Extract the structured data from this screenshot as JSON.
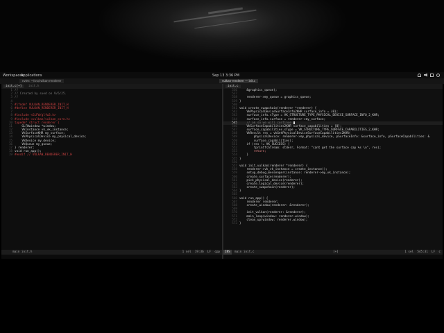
{
  "topbar": {
    "workspaces": "Workspaces",
    "applications": "Applications",
    "clock": "Sep 13 3:36 PM"
  },
  "windows": [
    {
      "title": "nvim: ~/src/vulkan-renderer"
    },
    {
      "title": "vulkan-renderer — init.c"
    }
  ],
  "left_pane": {
    "tab_label": "init.c[+]",
    "tab_path": "init.h",
    "lines": [
      {
        "n": "1",
        "t": "//",
        "k": "c-comment"
      },
      {
        "n": "2",
        "t": "// Created by sued on 9/6/25.",
        "k": "c-comment"
      },
      {
        "n": "3",
        "t": "//",
        "k": "c-comment"
      },
      {
        "n": "4",
        "t": "",
        "k": "tx"
      },
      {
        "n": "5",
        "t": "#ifndef VULKAN_RENDERER_INIT_H",
        "k": "c-pre"
      },
      {
        "n": "6",
        "t": "#define VULKAN_RENDERER_INIT_H",
        "k": "c-pre"
      },
      {
        "n": "7",
        "t": "",
        "k": "tx"
      },
      {
        "n": "8",
        "t": "#include <GLFW/glfw3.h>",
        "k": "c-pre"
      },
      {
        "n": "9",
        "t": "#include <vulkan/vulkan_core.h>",
        "k": "c-pre"
      },
      {
        "n": "10",
        "t": "typedef struct renderer {",
        "k": "c-pre"
      },
      {
        "n": "11",
        "t": "    GLFWwindow *window;",
        "k": "tx"
      },
      {
        "n": "12",
        "t": "    VkInstance vk_vk_instance;",
        "k": "tx"
      },
      {
        "n": "13",
        "t": "    VkSurfaceKHR my_surface;",
        "k": "tx"
      },
      {
        "n": "14",
        "t": "    VkPhysicalDevice my_physical_device;",
        "k": "tx"
      },
      {
        "n": "15",
        "t": "    VkDevice my_device;",
        "k": "tx"
      },
      {
        "n": "16",
        "t": "    VkQueue my_queue;",
        "k": "tx"
      },
      {
        "n": "17",
        "t": "} renderer;",
        "k": "tx"
      },
      {
        "n": "18",
        "t": "void run_app();",
        "k": "tx"
      },
      {
        "n": "19",
        "t": "#endif // VULKAN_RENDERER_INIT_H",
        "k": "c-pre"
      }
    ],
    "status": {
      "mode": "",
      "file": "main init.h",
      "sel": "1 sel",
      "pos": "19:36",
      "eol": "LF",
      "ft": "cpp"
    }
  },
  "right_pane": {
    "tab_label": "init.c",
    "lines": [
      {
        "n": "536",
        "t": "    &graphics_queue);",
        "k": "tx"
      },
      {
        "n": "537",
        "t": "",
        "k": "tx"
      },
      {
        "n": "538",
        "t": "    renderer->my_queue = graphics_queue;",
        "k": "tx"
      },
      {
        "n": "539",
        "t": "}",
        "k": "tx"
      },
      {
        "n": "540",
        "t": "",
        "k": "tx"
      },
      {
        "n": "541",
        "t": "void create_swapchain(renderer *renderer) {",
        "k": "tx"
      },
      {
        "n": "542",
        "t": "    VkPhysicalDeviceSurfaceInfo2KHR surface_info = {0};",
        "k": "tx"
      },
      {
        "n": "543",
        "t": "    surface_info.sType = VK_STRUCTURE_TYPE_PHYSICAL_DEVICE_SURFACE_INFO_2_KHR;",
        "k": "tx"
      },
      {
        "n": "544",
        "t": "    surface_info.surface = renderer->my_surface;",
        "k": "tx"
      },
      {
        "n": "545",
        "t": "    // ok so we will continue ",
        "k": "c-comment",
        "cur": true
      },
      {
        "n": "546",
        "t": "    VkSurfaceCapabilities2KHR surface_capabilities = {0};",
        "k": "tx"
      },
      {
        "n": "547",
        "t": "    surface_capabilities.sType = VK_STRUCTURE_TYPE_SURFACE_CAPABILITIES_2_KHR;",
        "k": "tx"
      },
      {
        "n": "548",
        "t": "    VkResult res = vkGetPhysicalDeviceSurfaceCapabilities2KHR(",
        "k": "tx"
      },
      {
        "n": "549",
        "t": "        physicalDevice: renderer->my_physical_device, pSurfaceInfo: &surface_info, pSurfaceCapabilities: &",
        "k": "tx"
      },
      {
        "n": "550",
        "t": "        surface_capabilities);",
        "k": "tx"
      },
      {
        "n": "551",
        "t": "    if (res != VK_SUCCESS) {",
        "k": "tx"
      },
      {
        "n": "552",
        "t": "        fprintf(Stream: stderr, Format: \"cant get the surface cap %s \\n\", res);",
        "k": "tx"
      },
      {
        "n": "553",
        "t": "        return;",
        "k": "c-str"
      },
      {
        "n": "554",
        "t": "    }",
        "k": "tx"
      },
      {
        "n": "555",
        "t": "}",
        "k": "tx"
      },
      {
        "n": "556",
        "t": "",
        "k": "tx"
      },
      {
        "n": "557",
        "t": "void init_vulkan(renderer *renderer) {",
        "k": "tx"
      },
      {
        "n": "558",
        "t": "    renderer->vk_vk_instance = create_instance();",
        "k": "tx"
      },
      {
        "n": "559",
        "t": "    setup_debug_messenger(instance: renderer->my_vk_instance);",
        "k": "tx"
      },
      {
        "n": "560",
        "t": "    create_surface(renderer);",
        "k": "tx"
      },
      {
        "n": "561",
        "t": "    pick_physical_device(renderer);",
        "k": "tx"
      },
      {
        "n": "562",
        "t": "    create_logical_device(renderer);",
        "k": "tx"
      },
      {
        "n": "563",
        "t": "    create_swapchain(renderer);",
        "k": "tx"
      },
      {
        "n": "564",
        "t": "}",
        "k": "tx"
      },
      {
        "n": "565",
        "t": "",
        "k": "tx"
      },
      {
        "n": "566",
        "t": "void run_app() {",
        "k": "tx"
      },
      {
        "n": "567",
        "t": "    renderer renderer;",
        "k": "tx"
      },
      {
        "n": "568",
        "t": "    create_window(renderer: &renderer);",
        "k": "tx"
      },
      {
        "n": "569",
        "t": "",
        "k": "tx"
      },
      {
        "n": "570",
        "t": "    init_vulkan(renderer: &renderer);",
        "k": "tx"
      },
      {
        "n": "571",
        "t": "    main_loop(window: renderer.window);",
        "k": "tx"
      },
      {
        "n": "572",
        "t": "    clean_up(window: renderer.window);",
        "k": "tx"
      },
      {
        "n": "573",
        "t": "}",
        "k": "tx"
      }
    ],
    "status": {
      "mode": "INS",
      "file": "main init.c",
      "modified": "[+]",
      "sel": "1 sel",
      "pos": "545:31",
      "eol": "LF",
      "ft": "c"
    }
  },
  "colors": {
    "background": "#000000",
    "editor_bg": "#101010",
    "preprocessor": "#c84040",
    "comment": "#7a7a7a"
  }
}
